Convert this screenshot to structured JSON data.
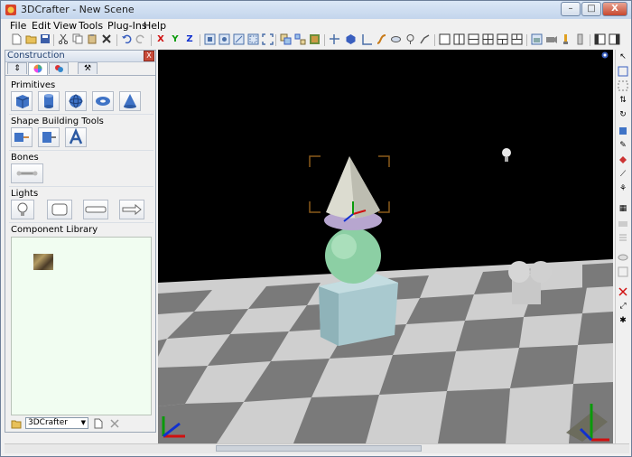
{
  "window": {
    "title": "3DCrafter - New Scene",
    "controls": [
      "–",
      "□",
      "X"
    ]
  },
  "menu": [
    "File",
    "Edit",
    "View",
    "Tools",
    "Plug-Ins",
    "Help"
  ],
  "toolbar": {
    "axis_x": "X",
    "axis_y": "Y",
    "axis_z": "Z",
    "icons": [
      "new-icon",
      "open-icon",
      "save-icon",
      "cut-icon",
      "copy-icon",
      "paste-icon",
      "delete-icon",
      "undo-icon",
      "redo-icon"
    ]
  },
  "panel": {
    "title": "Construction",
    "close": "X",
    "tabs": [
      "down-up-arrows-icon",
      "color-wheel-icon",
      "paint-icon",
      "tools-icon"
    ]
  },
  "sections": {
    "primitives": "Primitives",
    "shape_tools": "Shape Building Tools",
    "bones": "Bones",
    "lights": "Lights",
    "library": "Component Library"
  },
  "library_footer": {
    "combo_value": "3DCrafter"
  },
  "colors": {
    "viewport_bg": "#000000",
    "library_bg": "#f1fdf1",
    "accent_red": "#d01010",
    "accent_green": "#0a9a0a",
    "accent_blue": "#1030d0"
  }
}
